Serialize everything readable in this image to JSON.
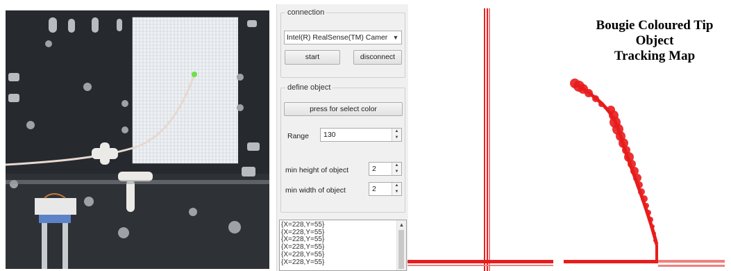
{
  "camera": {
    "title": "camera-feed",
    "accent_dot": "#6ee04a"
  },
  "panel": {
    "connection": {
      "title": "connection",
      "device_selected": "Intel(R) RealSense(TM) Camer",
      "start_label": "start",
      "disconnect_label": "disconnect"
    },
    "define_object": {
      "title": "define object",
      "select_color_label": "press for select color",
      "range_label": "Range",
      "range_value": "130",
      "min_height_label": "min height of object",
      "min_height_value": "2",
      "min_width_label": "min width of object",
      "min_width_value": "2"
    },
    "log": {
      "lines": [
        "{X=228,Y=55}",
        "{X=228,Y=55}",
        "{X=228,Y=55}",
        "{X=228,Y=55}",
        "{X=228,Y=55}",
        "{X=228,Y=55}"
      ]
    }
  },
  "map": {
    "title_line1": "Bougie Coloured Tip",
    "title_line2": "Object",
    "title_line3": "Tracking Map",
    "track_color": "#e81c1c"
  }
}
